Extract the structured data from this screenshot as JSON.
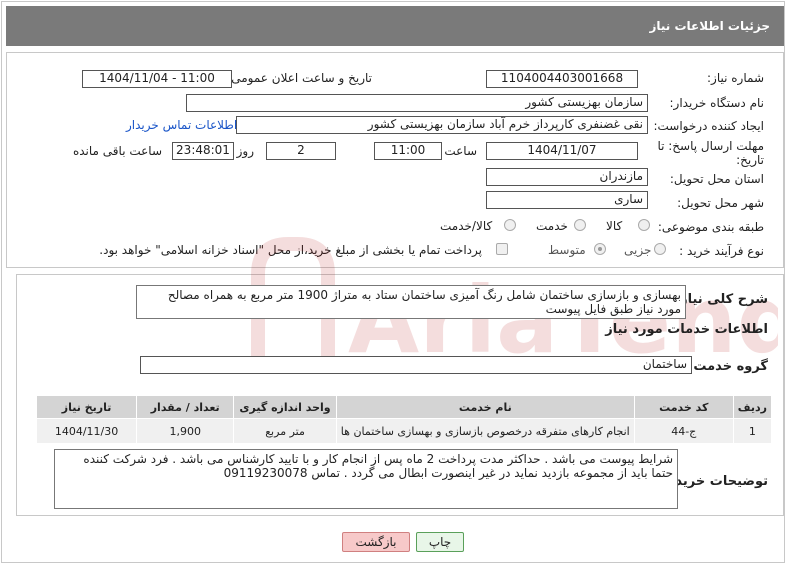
{
  "header": {
    "title": "جزئیات اطلاعات نیاز"
  },
  "fields": {
    "need_number_label": "شماره نیاز:",
    "need_number": "1104004403001668",
    "announce_label": "تاریخ و ساعت اعلان عمومی:",
    "announce_value": "1404/11/04 - 11:00",
    "buyer_org_label": "نام دستگاه خریدار:",
    "buyer_org": "سازمان بهزیستی کشور",
    "creator_label": "ایجاد کننده درخواست:",
    "creator": "نقی غضنفری کارپرداز خرم آباد سازمان بهزیستی کشور",
    "contact_link": "اطلاعات تماس خریدار",
    "deadline_label": "مهلت ارسال پاسخ: تا تاریخ:",
    "deadline_date": "1404/11/07",
    "time_label": "ساعت",
    "deadline_time": "11:00",
    "days_value": "2",
    "days_label": "روز و",
    "remaining_value": "23:48:01",
    "remaining_label": "ساعت باقی مانده",
    "province_label": "استان محل تحویل:",
    "province": "مازندران",
    "city_label": "شهر محل تحویل:",
    "city": "ساری",
    "category_label": "طبقه بندی موضوعی:",
    "category_options": [
      "کالا",
      "خدمت",
      "کالا/خدمت"
    ],
    "process_label": "نوع فرآیند خرید :",
    "process_options": [
      "جزیی",
      "متوسط"
    ],
    "payment_note": "پرداخت تمام یا بخشی از مبلغ خرید،از محل \"اسناد خزانه اسلامی\" خواهد بود."
  },
  "summary": {
    "label": "شرح کلی نیاز:",
    "text": "بهسازی و بازسازی ساختمان شامل رنگ آمیزی ساختمان ستاد به متراژ 1900 متر مربع به همراه مصالح مورد نیاز طبق فایل پیوست"
  },
  "services": {
    "section_title": "اطلاعات خدمات مورد نیاز",
    "group_label": "گروه خدمت:",
    "group_value": "ساختمان",
    "columns": [
      "ردیف",
      "کد خدمت",
      "نام خدمت",
      "واحد اندازه گیری",
      "تعداد / مقدار",
      "تاریخ نیاز"
    ],
    "rows": [
      [
        "1",
        "ج-44",
        "انجام کارهای متفرقه درخصوص بازسازی و بهسازی ساختمان ها",
        "متر مربع",
        "1,900",
        "1404/11/30"
      ]
    ]
  },
  "buyer_notes": {
    "label": "توضیحات خریدار:",
    "text": "شرایط پیوست می باشد . حداکثر مدت پرداخت 2 ماه پس از انجام کار و با تایید کارشناس می باشد . فرد شرکت کننده حتما باید از مجموعه بازدید نماید در غیر اینصورت ابطال می گردد . تماس 09119230078"
  },
  "buttons": {
    "print": "چاپ",
    "back": "بازگشت"
  },
  "watermark": {
    "text": "AriaTender.neT"
  },
  "colors": {
    "header_bg": "#7a7a7a",
    "link": "#1a55c8",
    "back_btn_bg": "#f7c9c9",
    "back_btn_border": "#d08080",
    "print_btn_bg": "#e8f6e8",
    "print_btn_border": "#5aa05a"
  }
}
